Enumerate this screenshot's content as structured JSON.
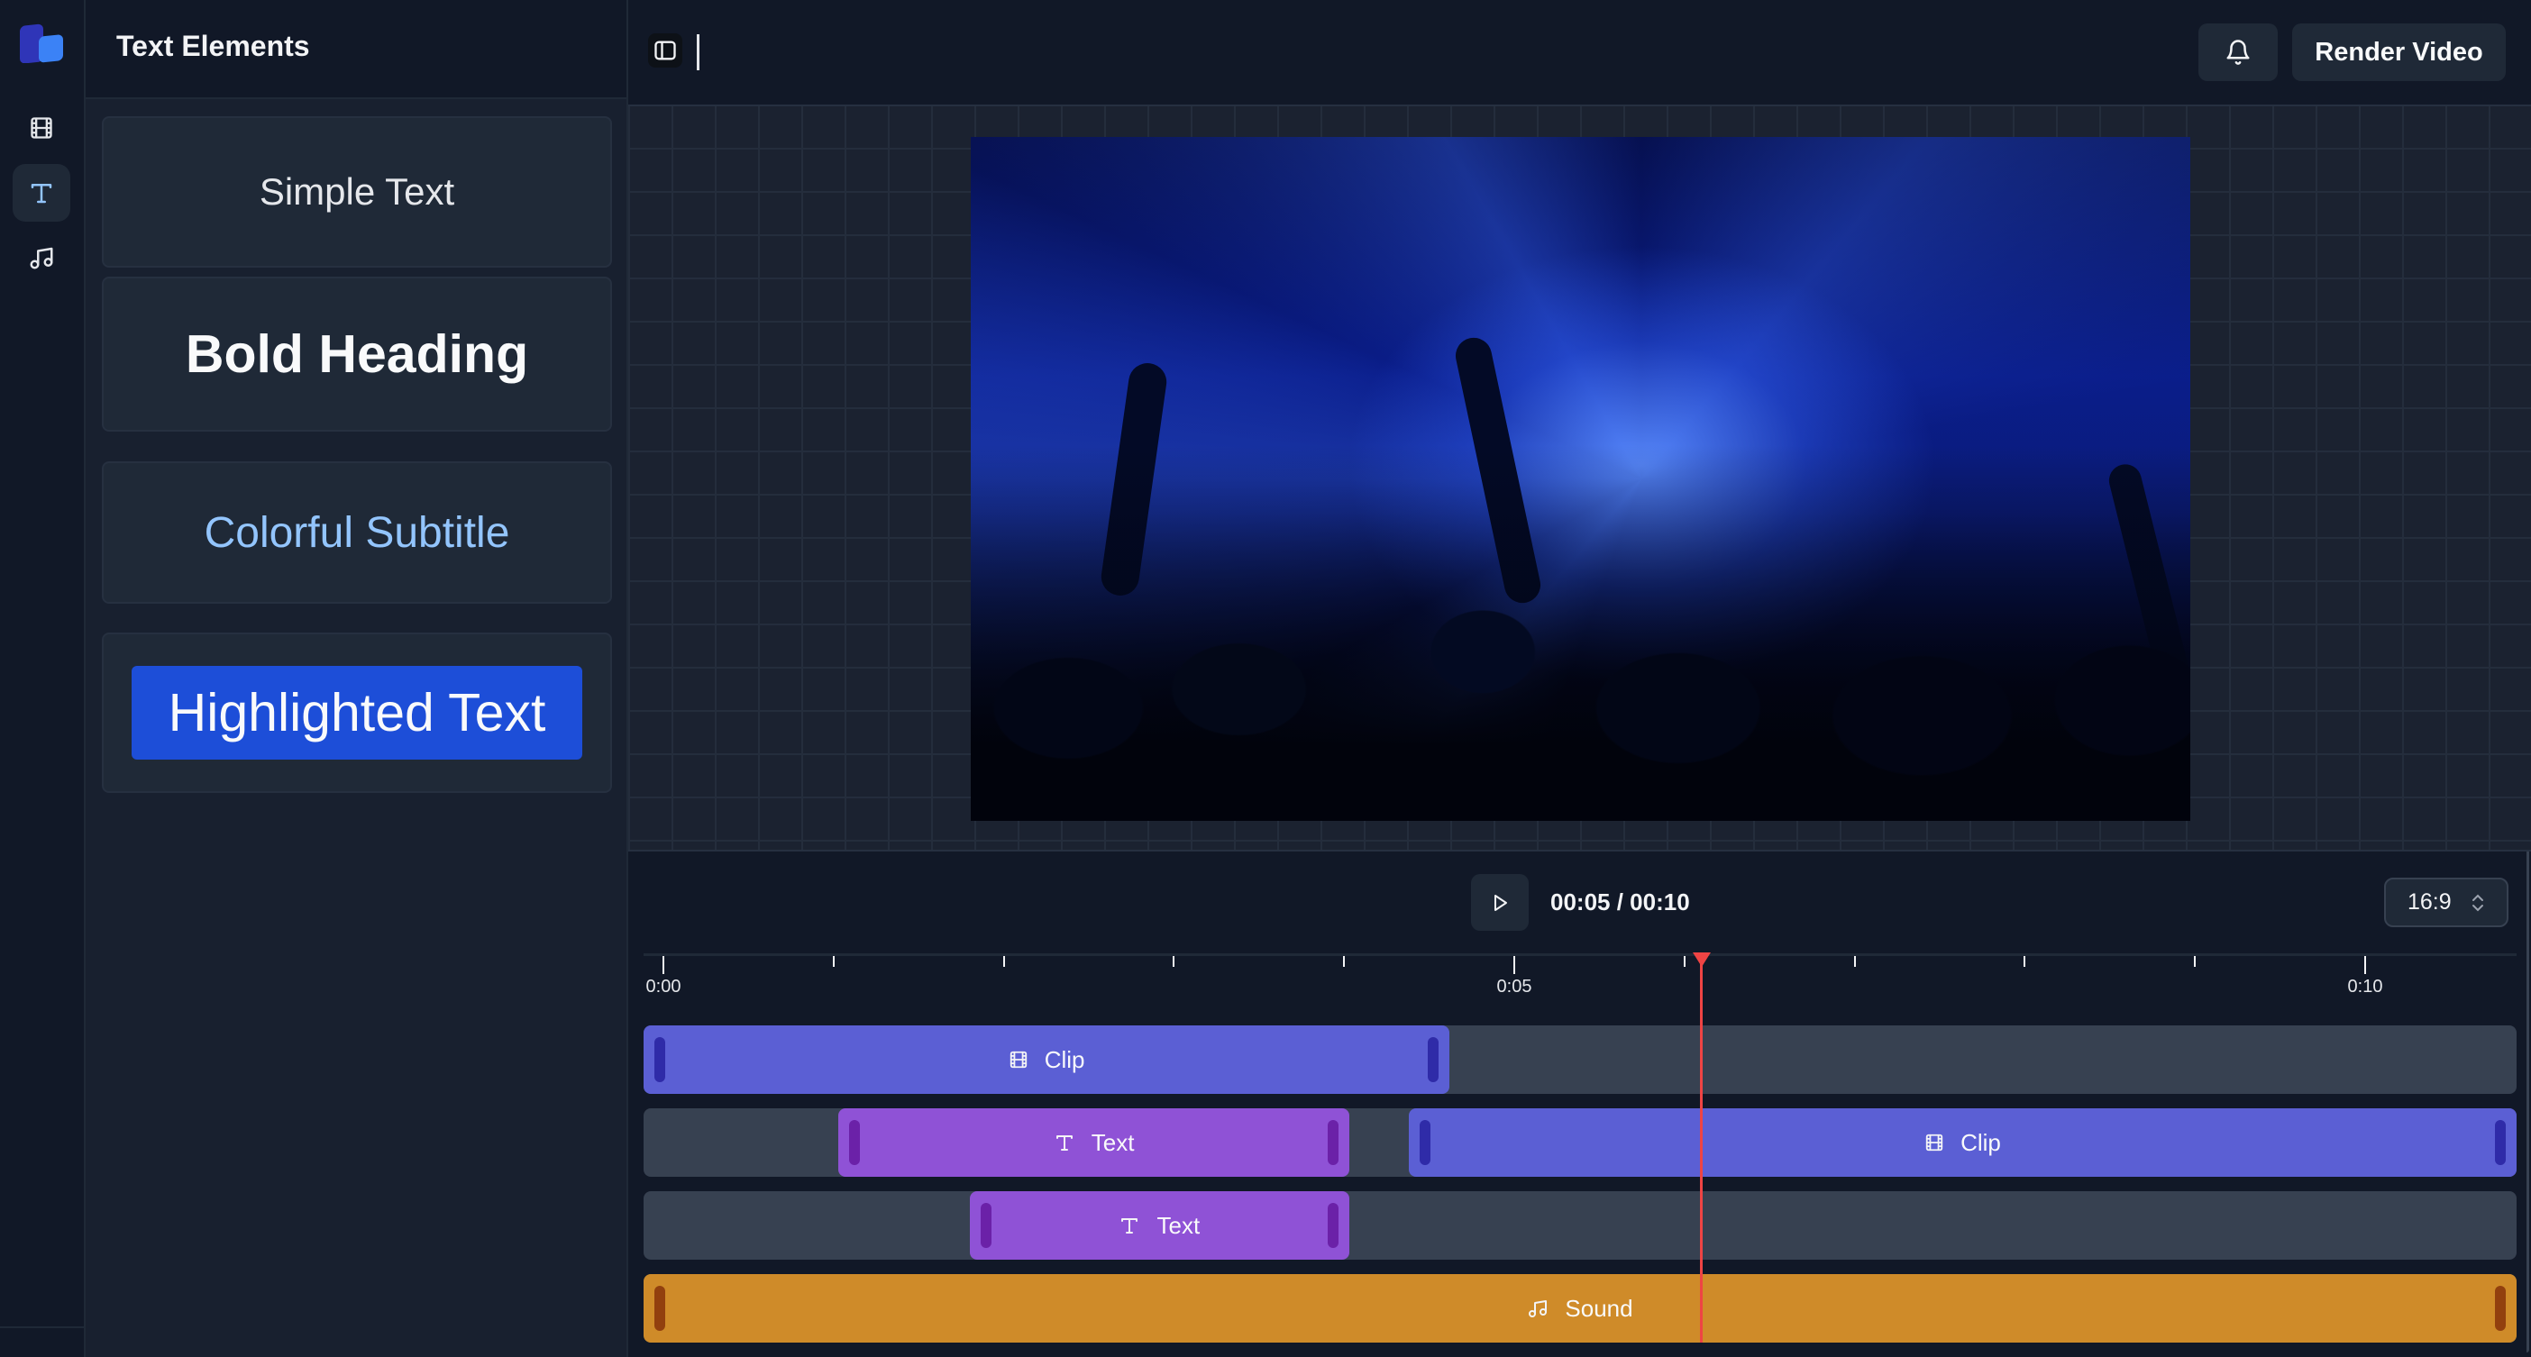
{
  "app": {
    "brand_colors": {
      "logo_back": "#2f35b8",
      "logo_front": "#3b82f6"
    }
  },
  "rail": {
    "items": [
      {
        "name": "media",
        "icon": "film-icon",
        "active": false
      },
      {
        "name": "text",
        "icon": "type-icon",
        "active": true
      },
      {
        "name": "audio",
        "icon": "music-icon",
        "active": false
      }
    ],
    "active_color": "#93c5fd"
  },
  "panel": {
    "title": "Text Elements",
    "presets": [
      {
        "label": "Simple Text",
        "style": "simple"
      },
      {
        "label": "Bold Heading",
        "style": "bold"
      },
      {
        "label": "Colorful Subtitle",
        "style": "colorful",
        "color": "#93c5fd"
      },
      {
        "label": "Highlighted Text",
        "style": "highlight",
        "background": "#1d4ed8"
      }
    ]
  },
  "header": {
    "toggle_sidebar_icon": "sidebar-toggle-icon",
    "notifications_icon": "bell-icon",
    "render_label": "Render Video"
  },
  "preview": {
    "description": "Concert crowd under blue stage lights",
    "aspect_ratio": "16:9"
  },
  "player": {
    "current_time": "00:05",
    "duration": "00:10",
    "time_display": "00:05 / 00:10",
    "aspect_options_selected": "16:9"
  },
  "timeline": {
    "ruler_labels": [
      "0:00",
      "0:05",
      "0:10"
    ],
    "major_tick_seconds": [
      0,
      5,
      10
    ],
    "minor_tick_seconds": [
      1,
      2,
      3,
      4,
      6,
      7,
      8,
      9
    ],
    "playhead_seconds": 6.1,
    "visible_end_seconds": 10.9,
    "colors": {
      "clip": "#5b5fd4",
      "text": "#8f52d6",
      "sound": "#cf8b29",
      "playhead": "#ef4444",
      "empty": "#374151"
    },
    "tracks": [
      {
        "segments": [
          {
            "type": "clip",
            "label": "Clip",
            "icon": "film-icon",
            "start": -0.12,
            "end": 4.62
          }
        ]
      },
      {
        "segments": [
          {
            "type": "text",
            "label": "Text",
            "icon": "type-icon",
            "start": 1.03,
            "end": 4.03
          },
          {
            "type": "clip",
            "label": "Clip",
            "icon": "film-icon",
            "start": 4.38,
            "end": 10.9
          }
        ]
      },
      {
        "segments": [
          {
            "type": "text",
            "label": "Text",
            "icon": "type-icon",
            "start": 1.8,
            "end": 4.03
          }
        ]
      },
      {
        "segments": [
          {
            "type": "sound",
            "label": "Sound",
            "icon": "music-icon",
            "start": -0.12,
            "end": 10.9
          }
        ]
      }
    ]
  }
}
